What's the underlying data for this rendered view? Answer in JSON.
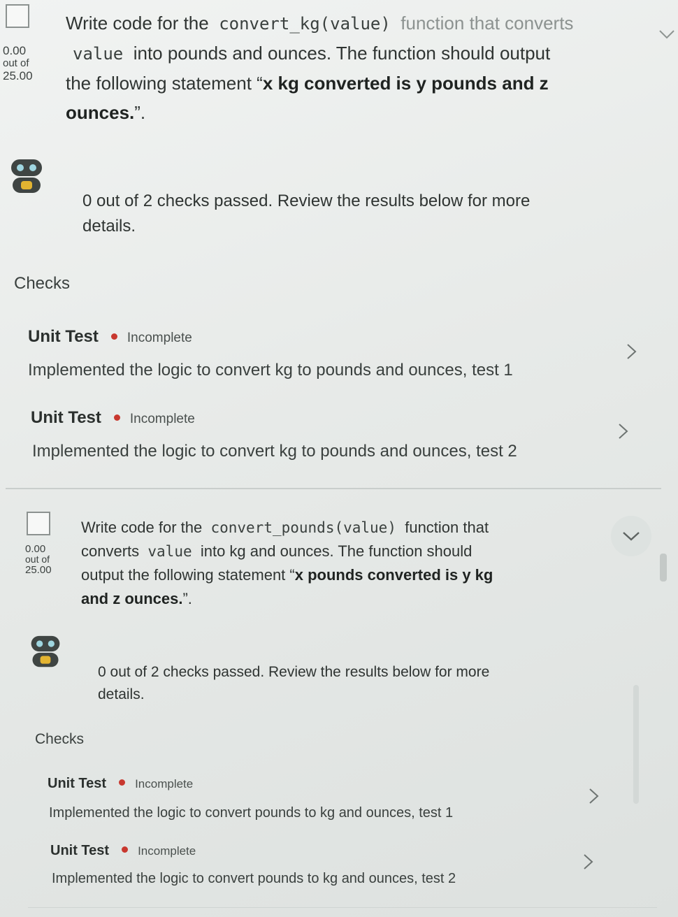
{
  "question1": {
    "score_points": "0.00",
    "score_out_of": "out of",
    "score_total": "25.00",
    "prompt_pre": "Write code for the",
    "prompt_code": "convert_kg(value)",
    "prompt_mid": "function that converts",
    "prompt_code2": "value",
    "prompt_line2": "into pounds and ounces. The function should output",
    "prompt_line3": "the following statement “",
    "prompt_bold": "x kg converted is y pounds and z",
    "prompt_bold2": "ounces.",
    "prompt_end": "”.",
    "result_text_line1": "0 out of 2 checks passed. Review the results below for more",
    "result_text_line2": "details.",
    "checks_heading": "Checks",
    "checks": [
      {
        "title": "Unit Test",
        "status": "Incomplete",
        "description": "Implemented the logic to convert kg to pounds and ounces, test 1"
      },
      {
        "title": "Unit Test",
        "status": "Incomplete",
        "description": "Implemented the logic to convert kg to pounds and ounces, test 2"
      }
    ]
  },
  "question2": {
    "score_points": "0.00",
    "score_out_of": "out of",
    "score_total": "25.00",
    "prompt_pre": "Write code for the",
    "prompt_code": "convert_pounds(value)",
    "prompt_mid": "function that",
    "prompt_line2_pre": "converts",
    "prompt_code2": "value",
    "prompt_line2_post": "into kg and ounces. The function should",
    "prompt_line3": "output the following statement “",
    "prompt_bold": "x pounds converted is y kg",
    "prompt_bold2": "and z ounces.",
    "prompt_end": "”.",
    "result_text_line1": "0 out of 2 checks passed. Review the results below for more",
    "result_text_line2": "details.",
    "checks_heading": "Checks",
    "checks": [
      {
        "title": "Unit Test",
        "status": "Incomplete",
        "description": "Implemented the logic to convert pounds to kg and ounces, test 1"
      },
      {
        "title": "Unit Test",
        "status": "Incomplete",
        "description": "Implemented the logic to convert pounds to kg and ounces, test 2"
      }
    ]
  },
  "colors": {
    "status_dot": "#c8382f",
    "background": "#e7eae8"
  },
  "icons": {
    "robot": "robot-icon",
    "chevron_right": "chevron-right-icon",
    "chevron_down": "chevron-down-icon"
  }
}
